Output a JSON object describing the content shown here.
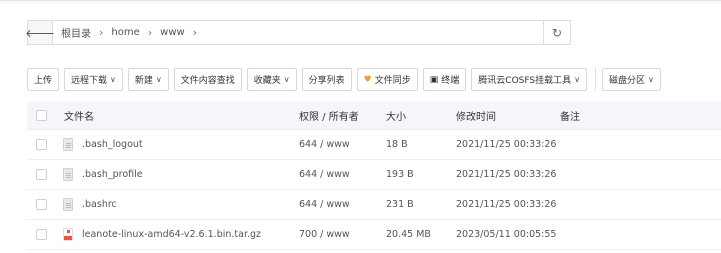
{
  "pathbar": {
    "back_icon": "arrow-left-icon",
    "crumbs": [
      "根目录",
      "home",
      "www"
    ],
    "separator": "›",
    "refresh_icon": "refresh-icon"
  },
  "toolbar": {
    "upload": "上传",
    "remote_download": "远程下载",
    "new": "新建",
    "search_content": "文件内容查找",
    "favorites": "收藏夹",
    "share_list": "分享列表",
    "sync": "文件同步",
    "terminal": "终端",
    "tencent_cos": "腾讯云COSFS挂载工具",
    "disk_partition": "磁盘分区",
    "caret": "∨"
  },
  "table": {
    "headers": {
      "name": "文件名",
      "perm": "权限 / 所有者",
      "size": "大小",
      "time": "修改时间",
      "note": "备注"
    },
    "rows": [
      {
        "name": ".bash_logout",
        "perm": "644 / www",
        "size": "18 B",
        "time": "2021/11/25 00:33:26",
        "note": "",
        "icon": "text-file-icon"
      },
      {
        "name": ".bash_profile",
        "perm": "644 / www",
        "size": "193 B",
        "time": "2021/11/25 00:33:26",
        "note": "",
        "icon": "text-file-icon"
      },
      {
        "name": ".bashrc",
        "perm": "644 / www",
        "size": "231 B",
        "time": "2021/11/25 00:33:26",
        "note": "",
        "icon": "text-file-icon"
      },
      {
        "name": "leanote-linux-amd64-v2.6.1.bin.tar.gz",
        "perm": "700 / www",
        "size": "20.45 MB",
        "time": "2023/05/11 00:05:55",
        "note": "",
        "icon": "archive-file-icon"
      }
    ]
  },
  "colors": {
    "header_bg": "#f5f6fa",
    "border": "#dcdcdc",
    "sync_icon": "#f0a020",
    "archive_icon": "#e8553e"
  }
}
